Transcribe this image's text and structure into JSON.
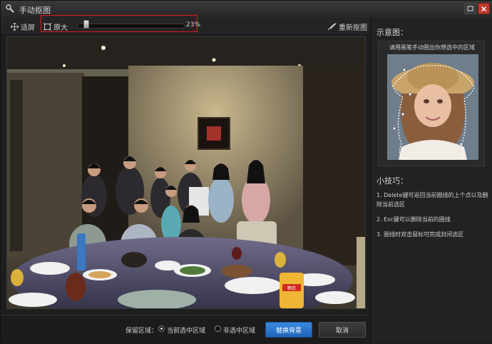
{
  "window": {
    "title": "手动抠图",
    "minimize_icon": "minimize-icon",
    "close_icon": "close-icon"
  },
  "toolbar": {
    "fit_label": "适屏",
    "zoom_label": "原大",
    "zoom_value": "23%",
    "zoom_level": 0.23,
    "redraw_label": "重新抠图"
  },
  "side": {
    "preview_heading": "示意图：",
    "preview_tip": "请用画笔手动圈出你想选中的区域",
    "tips_heading": "小技巧：",
    "tips": [
      "1. Delete键可返回当前圈线的上个点以及删除当前选区",
      "2. Esc键可以删除当前的圈线",
      "3. 圈线时双击鼠标可完成封闭选区"
    ]
  },
  "bottom": {
    "keep_label": "保留区域：",
    "option_selected": "当前选中区域",
    "option_unselected": "非选中区域",
    "replace_button": "替换背景",
    "cancel_button": "取消"
  },
  "colors": {
    "accent": "#2a74cc",
    "highlight_border": "#e01b1b",
    "close_button": "#c0392b"
  },
  "photo": {
    "package_label": "畅饮"
  }
}
